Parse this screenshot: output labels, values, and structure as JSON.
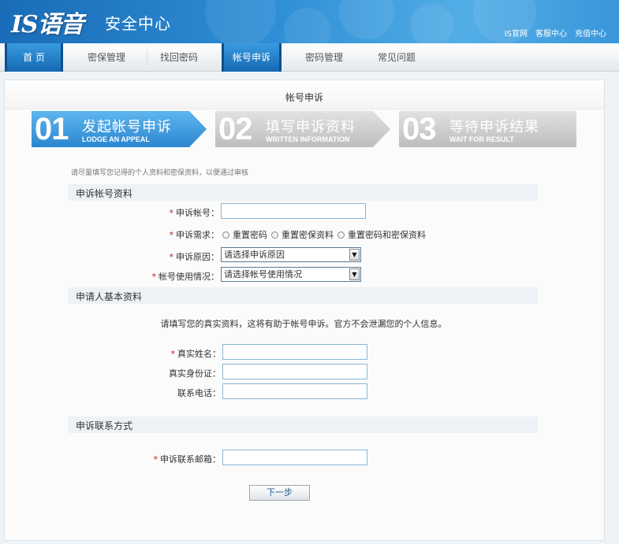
{
  "header": {
    "logo": "IS语音",
    "subtitle": "安全中心",
    "links": [
      "IS官网",
      "客服中心",
      "充值中心"
    ]
  },
  "nav": {
    "items": [
      "首 页",
      "密保管理",
      "找回密码",
      "帐号申诉",
      "密码管理",
      "常见问题"
    ],
    "active_index": 3
  },
  "panel": {
    "title": "帐号申诉"
  },
  "steps": [
    {
      "num": "01",
      "cn": "发起帐号申诉",
      "en": "LODGE AN APPEAL",
      "active": true
    },
    {
      "num": "02",
      "cn": "填写申诉资料",
      "en": "WRITTEN INFORMATION",
      "active": false
    },
    {
      "num": "03",
      "cn": "等待申诉结果",
      "en": "WAIT FOR RESULT",
      "active": false
    }
  ],
  "hint": "请尽量填写您记得的个人资料和密保资料，以便通过审核",
  "sections": {
    "account": "申诉帐号资料",
    "applicant": "申请人基本资料",
    "contact": "申诉联系方式"
  },
  "form": {
    "account_label": "申诉帐号：",
    "need_label": "申诉需求：",
    "need_options": [
      "重置密码",
      "重置密保资料",
      "重置密码和密保资料"
    ],
    "reason_label": "申诉原因：",
    "reason_value": "请选择申诉原因",
    "usage_label": "帐号使用情况：",
    "usage_value": "请选择帐号使用情况",
    "info_text": "请填写您的真实资料，这将有助于帐号申诉。官方不会泄漏您的个人信息。",
    "name_label": "真实姓名：",
    "id_label": "真实身份证：",
    "phone_label": "联系电话：",
    "email_label": "申诉联系邮箱：",
    "required_mark": "*",
    "next_button": "下一步"
  },
  "colors": {
    "header_blue": "#2f8fd6",
    "active_step": "#3a9be0",
    "inactive_step": "#c8c8c8",
    "required": "#dd1111"
  }
}
